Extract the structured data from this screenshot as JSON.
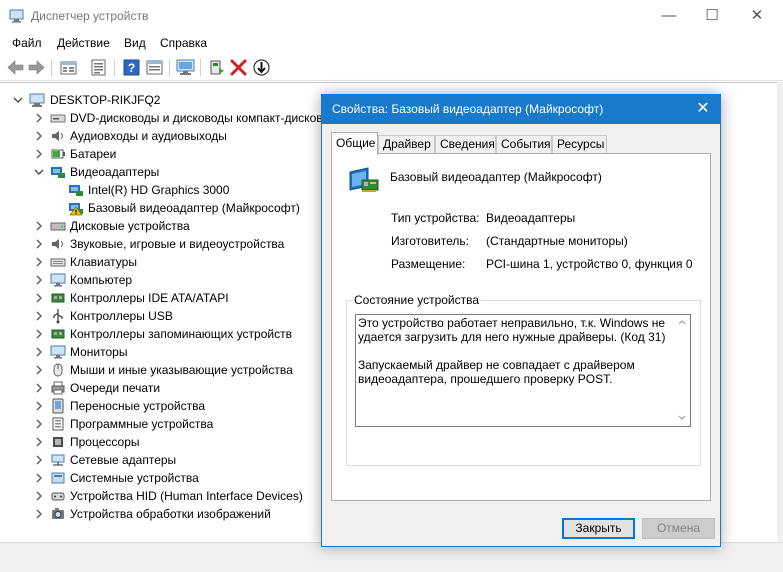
{
  "window": {
    "title": "Диспетчер устройств",
    "minimize": "—",
    "maximize": "☐",
    "close": "✕"
  },
  "menu": {
    "items": [
      "Файл",
      "Действие",
      "Вид",
      "Справка"
    ]
  },
  "toolbar": {
    "icons": [
      "back-arrow-icon",
      "forward-arrow-icon",
      "show-hidden-icon",
      "properties-sheet-icon",
      "help-icon",
      "view-resources-icon",
      "scan-hardware-icon",
      "update-driver-icon",
      "uninstall-icon",
      "disable-device-icon"
    ]
  },
  "tree": {
    "root": "DESKTOP-RIKJFQ2",
    "categories": [
      {
        "label": "DVD-дисководы и дисководы компакт-дисков",
        "icon": "dvd-drive-icon",
        "expanded": false
      },
      {
        "label": "Аудиовходы и аудиовыходы",
        "icon": "speaker-icon",
        "expanded": false
      },
      {
        "label": "Батареи",
        "icon": "battery-icon",
        "expanded": false
      },
      {
        "label": "Видеоадаптеры",
        "icon": "display-adapter-icon",
        "expanded": true,
        "children": [
          {
            "label": "Intel(R) HD Graphics 3000",
            "icon": "display-adapter-icon",
            "warning": false
          },
          {
            "label": "Базовый видеоадаптер (Майкрософт)",
            "icon": "display-adapter-warning-icon",
            "warning": true
          }
        ]
      },
      {
        "label": "Дисковые устройства",
        "icon": "disk-drive-icon",
        "expanded": false
      },
      {
        "label": "Звуковые, игровые и видеоустройства",
        "icon": "sound-device-icon",
        "expanded": false
      },
      {
        "label": "Клавиатуры",
        "icon": "keyboard-icon",
        "expanded": false
      },
      {
        "label": "Компьютер",
        "icon": "computer-icon",
        "expanded": false
      },
      {
        "label": "Контроллеры IDE ATA/ATAPI",
        "icon": "ide-controller-icon",
        "expanded": false
      },
      {
        "label": "Контроллеры USB",
        "icon": "usb-icon",
        "expanded": false
      },
      {
        "label": "Контроллеры запоминающих устройств",
        "icon": "storage-controller-icon",
        "expanded": false
      },
      {
        "label": "Мониторы",
        "icon": "monitor-icon",
        "expanded": false
      },
      {
        "label": "Мыши и иные указывающие устройства",
        "icon": "mouse-icon",
        "expanded": false
      },
      {
        "label": "Очереди печати",
        "icon": "print-queue-icon",
        "expanded": false
      },
      {
        "label": "Переносные устройства",
        "icon": "portable-device-icon",
        "expanded": false
      },
      {
        "label": "Программные устройства",
        "icon": "software-device-icon",
        "expanded": false
      },
      {
        "label": "Процессоры",
        "icon": "processor-icon",
        "expanded": false
      },
      {
        "label": "Сетевые адаптеры",
        "icon": "network-adapter-icon",
        "expanded": false
      },
      {
        "label": "Системные устройства",
        "icon": "system-device-icon",
        "expanded": false
      },
      {
        "label": "Устройства HID (Human Interface Devices)",
        "icon": "hid-icon",
        "expanded": false
      },
      {
        "label": "Устройства обработки изображений",
        "icon": "imaging-device-icon",
        "expanded": false
      }
    ]
  },
  "dialog": {
    "title": "Свойства: Базовый видеоадаптер (Майкрософт)",
    "close": "✕",
    "tabs": [
      {
        "label": "Общие",
        "active": true
      },
      {
        "label": "Драйвер",
        "active": false
      },
      {
        "label": "Сведения",
        "active": false
      },
      {
        "label": "События",
        "active": false
      },
      {
        "label": "Ресурсы",
        "active": false
      }
    ],
    "device_name": "Базовый видеоадаптер (Майкрософт)",
    "properties": [
      {
        "label": "Тип устройства:",
        "value": "Видеоадаптеры"
      },
      {
        "label": "Изготовитель:",
        "value": "(Стандартные мониторы)"
      },
      {
        "label": "Размещение:",
        "value": "PCI-шина 1, устройство 0, функция 0"
      }
    ],
    "status_group_title": "Состояние устройства",
    "status_lines": [
      "Это устройство работает неправильно, т.к. Windows не",
      "удается загрузить для него нужные драйверы. (Код 31)",
      "",
      "Запускаемый драйвер не совпадает с драйвером",
      "видеоадаптера, прошедшего проверку POST."
    ],
    "ok_label": "Закрыть",
    "cancel_label": "Отмена"
  },
  "colors": {
    "dialog_title_bg": "#1979ca",
    "accent": "#0078d7",
    "warning": "#f2c200"
  }
}
